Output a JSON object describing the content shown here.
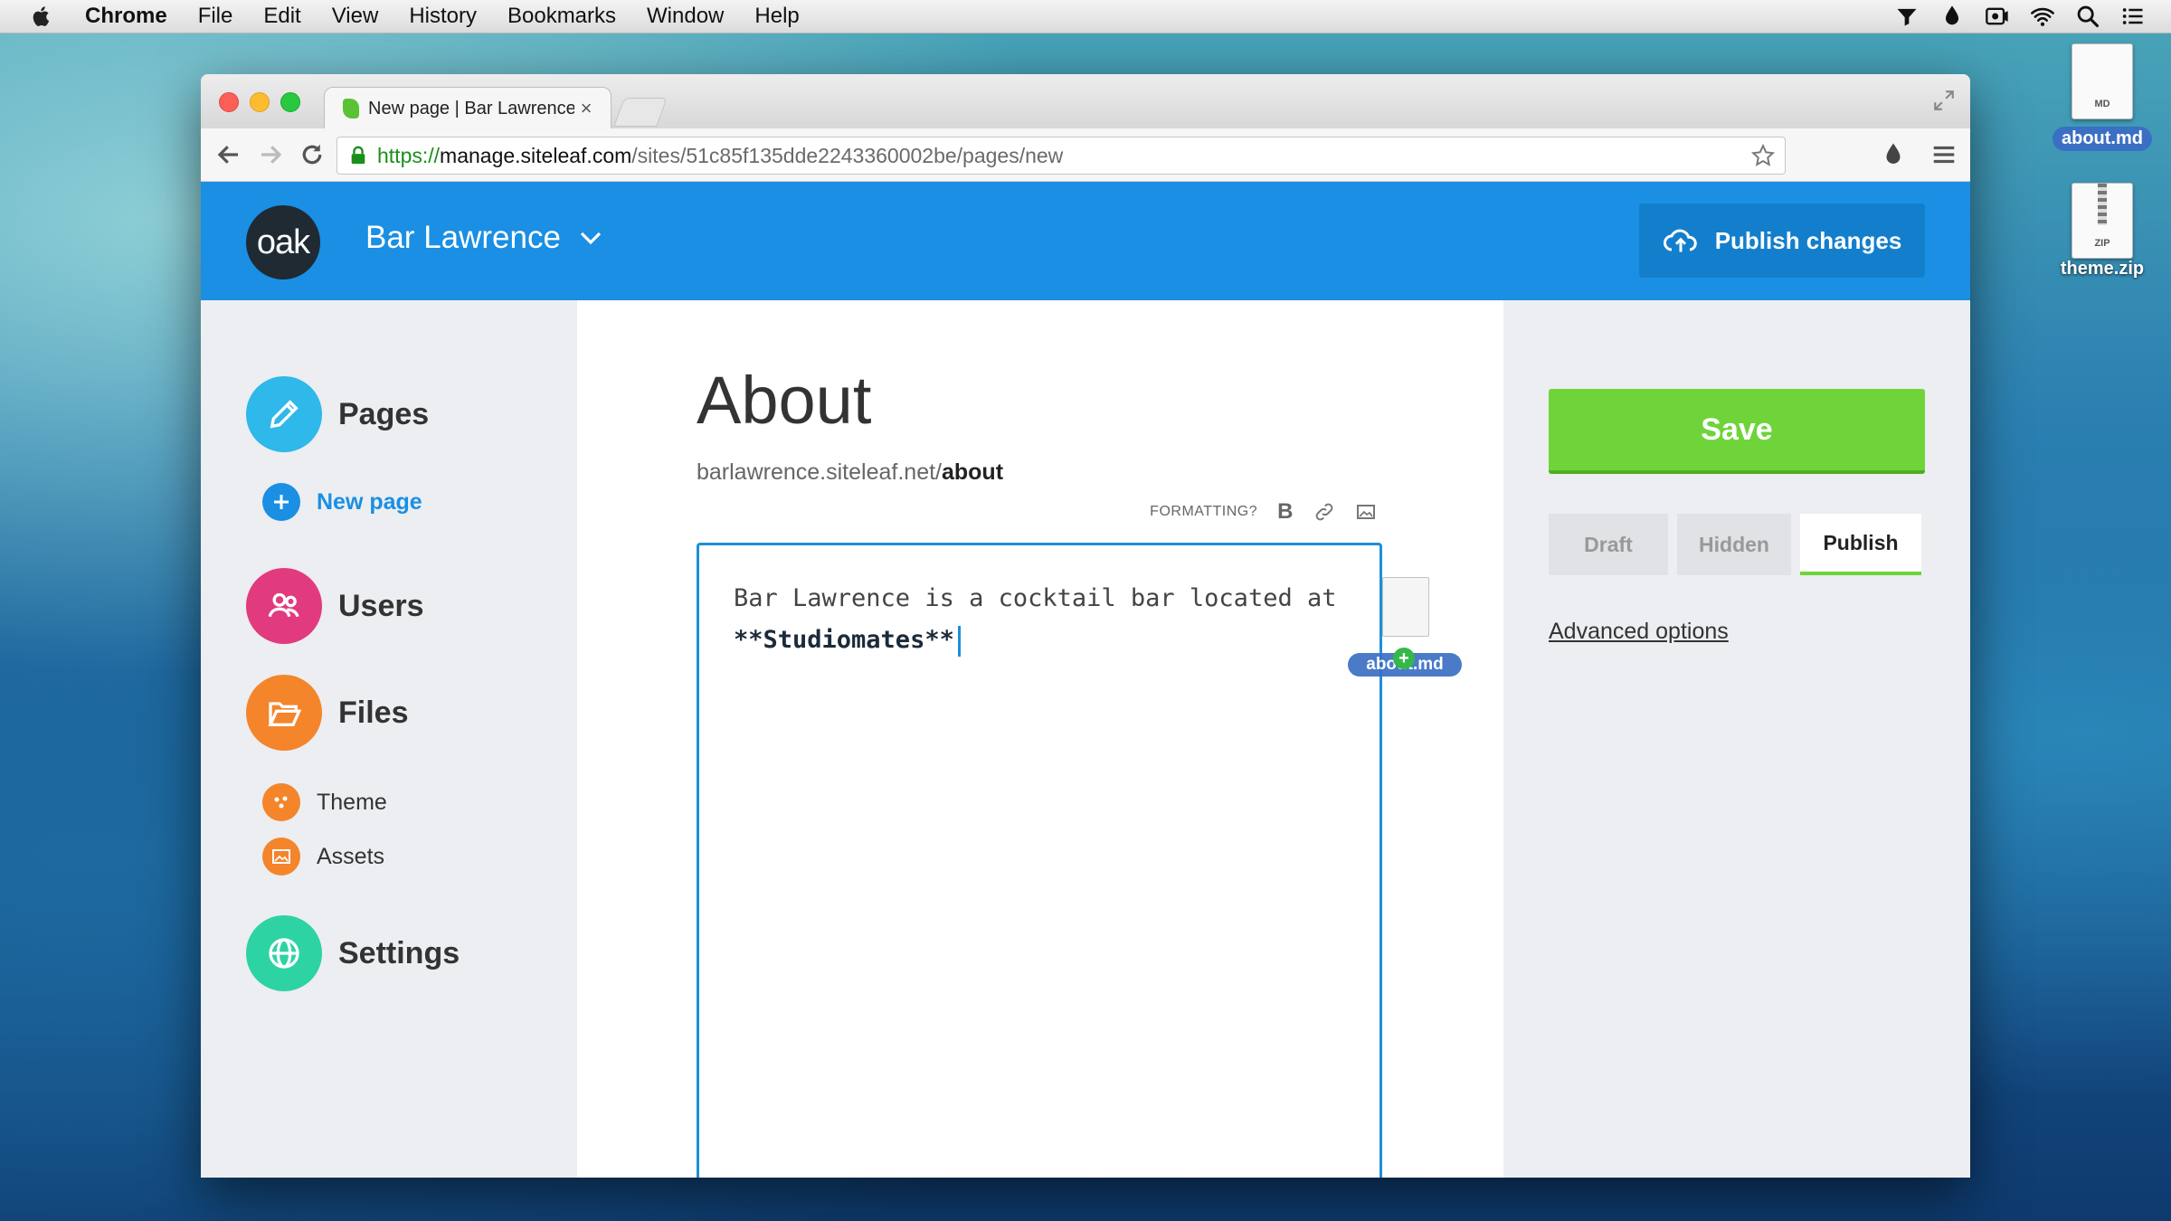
{
  "menubar": {
    "items": [
      "Chrome",
      "File",
      "Edit",
      "View",
      "History",
      "Bookmarks",
      "Window",
      "Help"
    ]
  },
  "desktop": {
    "icons": [
      {
        "label": "about.md",
        "tag": "MD"
      },
      {
        "label": "theme.zip",
        "tag": "ZIP"
      }
    ]
  },
  "browser": {
    "tab_title": "New page | Bar Lawrence",
    "tab_close": "×",
    "url": {
      "scheme": "https://",
      "host": "manage.siteleaf.com",
      "path": "/sites/51c85f135dde2243360002be/pages/new"
    }
  },
  "app": {
    "logo_text": "oak",
    "site_name": "Bar Lawrence",
    "publish_label": "Publish changes",
    "accent": "#1a8fe3"
  },
  "sidebar": {
    "pages": "Pages",
    "new_page": "New page",
    "users": "Users",
    "files": "Files",
    "theme": "Theme",
    "assets": "Assets",
    "settings": "Settings"
  },
  "editor": {
    "title": "About",
    "url_base": "barlawrence.siteleaf.net/",
    "url_slug": "about",
    "formatting_label": "FORMATTING?",
    "bold_label": "B",
    "body_plain": "Bar Lawrence is a cocktail bar located at ",
    "body_strong": "**Studiomates**",
    "drag_label": "about.md",
    "drag_plus": "+"
  },
  "right_panel": {
    "save_label": "Save",
    "status_options": [
      "Draft",
      "Hidden",
      "Publish"
    ],
    "selected_status": "Publish",
    "advanced_label": "Advanced options",
    "save_color": "#6ed43a"
  }
}
